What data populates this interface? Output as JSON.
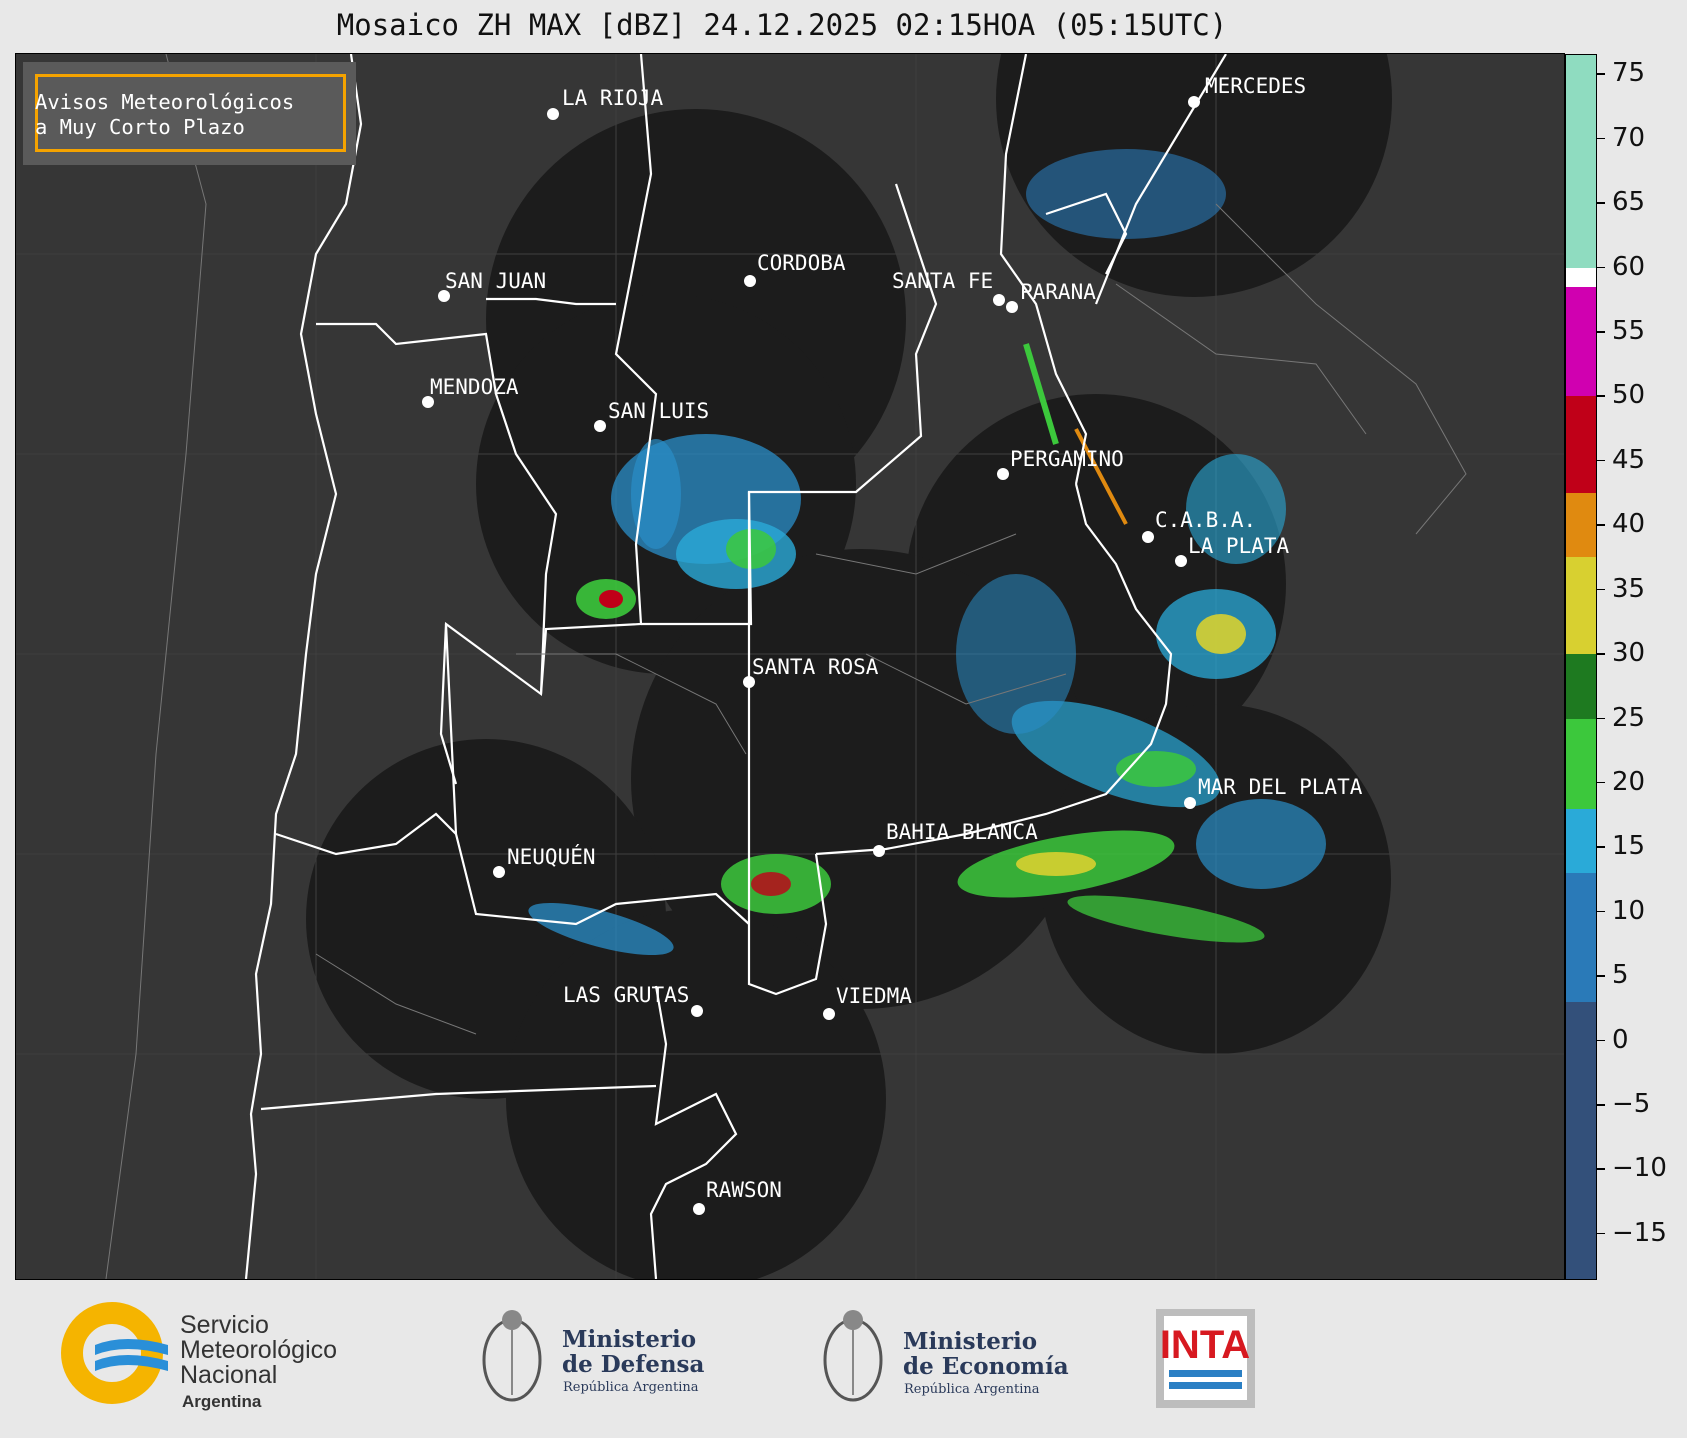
{
  "title": "Mosaico ZH MAX [dBZ] 24.12.2025 02:15HOA (05:15UTC)",
  "notice": {
    "line1": "Avisos Meteorológicos",
    "line2": "a Muy Corto Plazo"
  },
  "cities": [
    {
      "id": "la-rioja",
      "label": "LA RIOJA"
    },
    {
      "id": "mercedes",
      "label": "MERCEDES"
    },
    {
      "id": "cordoba",
      "label": "CORDOBA"
    },
    {
      "id": "san-juan",
      "label": "SAN JUAN"
    },
    {
      "id": "santa-fe",
      "label": "SANTA FE"
    },
    {
      "id": "parana",
      "label": "PARANA"
    },
    {
      "id": "mendoza",
      "label": "MENDOZA"
    },
    {
      "id": "san-luis",
      "label": "SAN LUIS"
    },
    {
      "id": "pergamino",
      "label": "PERGAMINO"
    },
    {
      "id": "caba",
      "label": "C.A.B.A."
    },
    {
      "id": "la-plata",
      "label": "LA PLATA"
    },
    {
      "id": "santa-rosa",
      "label": "SANTA ROSA"
    },
    {
      "id": "mar-del-plata",
      "label": "MAR DEL PLATA"
    },
    {
      "id": "bahia-blanca",
      "label": "BAHIA BLANCA"
    },
    {
      "id": "neuquen",
      "label": "NEUQUÉN"
    },
    {
      "id": "las-grutas",
      "label": "LAS GRUTAS"
    },
    {
      "id": "viedma",
      "label": "VIEDMA"
    },
    {
      "id": "rawson",
      "label": "RAWSON"
    }
  ],
  "colorbar": {
    "unit": "dBZ",
    "ticks": [
      "75",
      "70",
      "65",
      "60",
      "55",
      "50",
      "45",
      "40",
      "35",
      "30",
      "25",
      "20",
      "15",
      "10",
      "5",
      "0",
      "−5",
      "−10",
      "−15"
    ],
    "stops": [
      {
        "from": 76.5,
        "to": 60,
        "color": "#8fdcc0"
      },
      {
        "from": 60,
        "to": 58.5,
        "color": "#ffffff"
      },
      {
        "from": 58.5,
        "to": 50,
        "color": "#d000b0"
      },
      {
        "from": 50,
        "to": 42.5,
        "color": "#c00018"
      },
      {
        "from": 42.5,
        "to": 37.5,
        "color": "#e08a10"
      },
      {
        "from": 37.5,
        "to": 30,
        "color": "#d8d030"
      },
      {
        "from": 30,
        "to": 25,
        "color": "#1e7a20"
      },
      {
        "from": 25,
        "to": 18,
        "color": "#3cc83c"
      },
      {
        "from": 18,
        "to": 13,
        "color": "#2aaad8"
      },
      {
        "from": 13,
        "to": 3,
        "color": "#2a7ab8"
      },
      {
        "from": 3,
        "to": -18.5,
        "color": "#33507a"
      }
    ]
  },
  "logos": {
    "smn": {
      "line1": "Servicio",
      "line2": "Meteorológico",
      "line3": "Nacional",
      "line4": "Argentina"
    },
    "defensa": {
      "line1": "Ministerio",
      "line2": "de Defensa",
      "line3": "República Argentina"
    },
    "economia": {
      "line1": "Ministerio",
      "line2": "de Economía",
      "line3": "República Argentina"
    },
    "inta": {
      "label": "INTA"
    }
  }
}
